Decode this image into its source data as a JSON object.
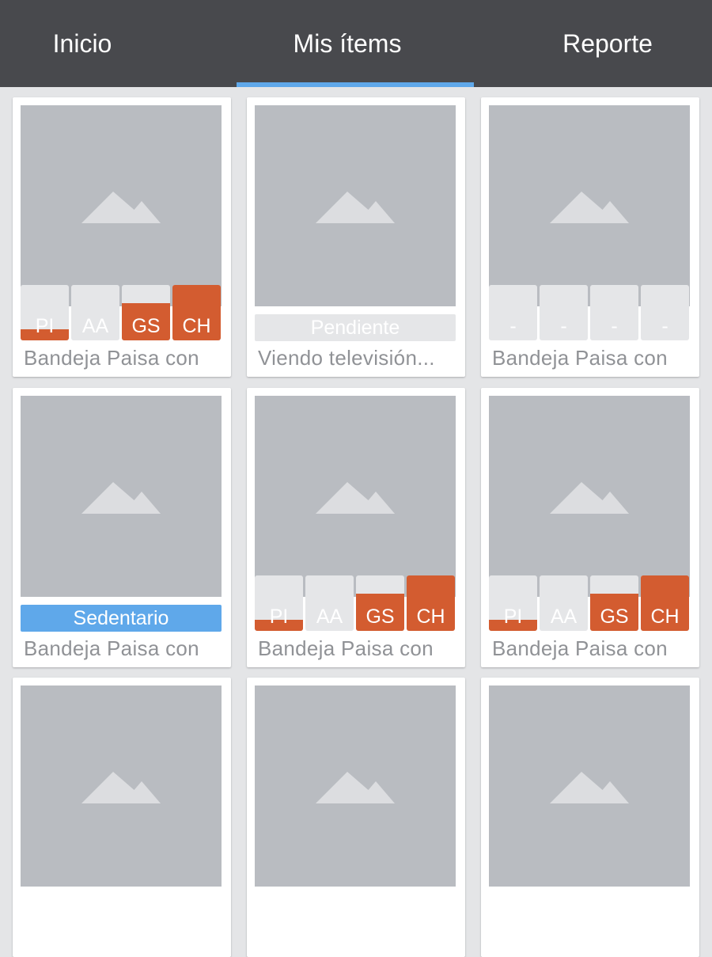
{
  "tabs": [
    {
      "label": "Inicio"
    },
    {
      "label": "Mis ítems"
    },
    {
      "label": "Reporte"
    }
  ],
  "colors": {
    "appbar": "#48494d",
    "indicator": "#5fa8ea",
    "tag_empty": "#e5e6e8",
    "tag_fill": "#d35c30",
    "pending": "#e5e6e8",
    "sedentary": "#5fa8ea"
  },
  "cards": [
    {
      "caption": "Bandeja Paisa con",
      "tags": [
        {
          "label": "PI",
          "level": 0.2
        },
        {
          "label": "AA",
          "level": 0
        },
        {
          "label": "GS",
          "level": 0.67
        },
        {
          "label": "CH",
          "level": 1
        }
      ]
    },
    {
      "caption": "Viendo televisión...",
      "status": {
        "label": "Pendiente",
        "color": "#e5e6e8"
      }
    },
    {
      "caption": "Bandeja Paisa con",
      "tags": [
        {
          "label": "-",
          "level": 0
        },
        {
          "label": "-",
          "level": 0
        },
        {
          "label": "-",
          "level": 0
        },
        {
          "label": "-",
          "level": 0
        }
      ]
    },
    {
      "caption": "Bandeja Paisa con",
      "status": {
        "label": "Sedentario",
        "color": "#5fa8ea"
      }
    },
    {
      "caption": "Bandeja Paisa con",
      "tags": [
        {
          "label": "PI",
          "level": 0.2
        },
        {
          "label": "AA",
          "level": 0
        },
        {
          "label": "GS",
          "level": 0.67
        },
        {
          "label": "CH",
          "level": 1
        }
      ]
    },
    {
      "caption": "Bandeja Paisa con",
      "tags": [
        {
          "label": "PI",
          "level": 0.2
        },
        {
          "label": "AA",
          "level": 0
        },
        {
          "label": "GS",
          "level": 0.67
        },
        {
          "label": "CH",
          "level": 1
        }
      ]
    },
    {
      "caption": ""
    },
    {
      "caption": ""
    },
    {
      "caption": ""
    }
  ]
}
